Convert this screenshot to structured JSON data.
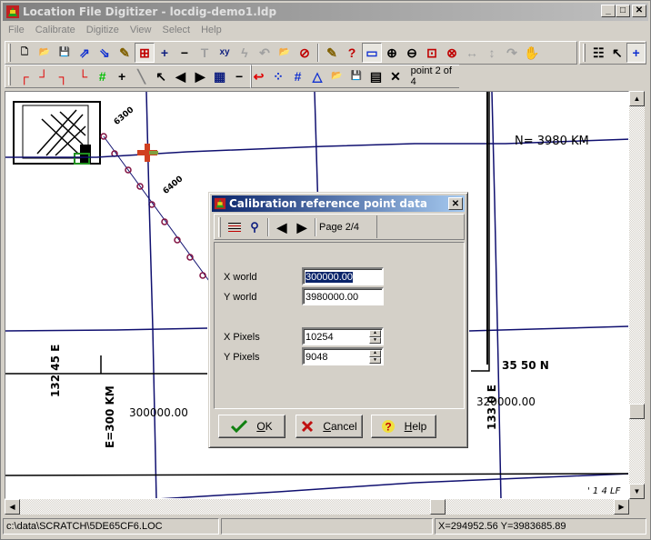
{
  "window": {
    "title": "Location File Digitizer - locdig-demo1.ldp",
    "buttons": {
      "minimize": "_",
      "maximize": "□",
      "close": "✕"
    }
  },
  "menu": [
    {
      "label": "File"
    },
    {
      "label": "Calibrate"
    },
    {
      "label": "Digitize"
    },
    {
      "label": "View"
    },
    {
      "label": "Select"
    },
    {
      "label": "Help"
    }
  ],
  "toolbar1": {
    "buttons": [
      {
        "name": "new-project",
        "glyph": "🗋",
        "color": "#000"
      },
      {
        "name": "open-project",
        "glyph": "📂",
        "color": "#c8a000"
      },
      {
        "name": "save-project",
        "glyph": "💾",
        "color": "#000"
      },
      {
        "name": "import",
        "glyph": "⇗",
        "color": "#1030d0"
      },
      {
        "name": "export",
        "glyph": "⇘",
        "color": "#1030d0"
      },
      {
        "name": "edit-notes",
        "glyph": "✎",
        "color": "#806000"
      },
      {
        "name": "calibrate-image",
        "glyph": "⊞",
        "color": "#c00000"
      },
      {
        "name": "add",
        "glyph": "+",
        "color": "#102080"
      },
      {
        "name": "remove",
        "glyph": "−",
        "color": "#000"
      },
      {
        "name": "text",
        "glyph": "T",
        "color": "#a0a0a0"
      },
      {
        "name": "xy-coords",
        "glyph": "xy",
        "color": "#102080"
      },
      {
        "name": "lightning",
        "glyph": "ϟ",
        "color": "#a0a0a0"
      },
      {
        "name": "undo",
        "glyph": "↶",
        "color": "#a0a0a0"
      },
      {
        "name": "open-image",
        "glyph": "📂",
        "color": "#c8a000"
      },
      {
        "name": "image-settings",
        "glyph": "⊘",
        "color": "#c00000"
      },
      {
        "name": "notes",
        "glyph": "✎",
        "color": "#806000"
      },
      {
        "name": "help",
        "glyph": "?",
        "color": "#c00000"
      },
      {
        "name": "select-rect",
        "glyph": "▭",
        "color": "#1030d0"
      },
      {
        "name": "zoom-in",
        "glyph": "⊕",
        "color": "#000"
      },
      {
        "name": "zoom-out",
        "glyph": "⊖",
        "color": "#000"
      },
      {
        "name": "zoom-window",
        "glyph": "⊡",
        "color": "#c00000"
      },
      {
        "name": "zoom-reset",
        "glyph": "⊗",
        "color": "#c00000"
      },
      {
        "name": "pan-horizontal",
        "glyph": "↔",
        "color": "#a0a0a0"
      },
      {
        "name": "pan-vertical",
        "glyph": "↕",
        "color": "#a0a0a0"
      },
      {
        "name": "redo",
        "glyph": "↷",
        "color": "#a0a0a0"
      },
      {
        "name": "hand",
        "glyph": "✋",
        "color": "#000"
      },
      {
        "name": "properties",
        "glyph": "☷",
        "color": "#000"
      },
      {
        "name": "pointer",
        "glyph": "↖",
        "color": "#000"
      },
      {
        "name": "crosshair",
        "glyph": "+",
        "color": "#1030d0"
      }
    ]
  },
  "toolbar2": {
    "buttons": [
      {
        "name": "corner-top-left",
        "glyph": "┌",
        "color": "#e00000"
      },
      {
        "name": "corner-top-right",
        "glyph": "┘",
        "color": "#e00000"
      },
      {
        "name": "corner-top-right-2",
        "glyph": "┐",
        "color": "#e00000"
      },
      {
        "name": "corner-bottom-left",
        "glyph": "└",
        "color": "#e00000"
      },
      {
        "name": "grid-point",
        "glyph": "#",
        "color": "#00c000"
      },
      {
        "name": "add-point",
        "glyph": "+",
        "color": "#000"
      },
      {
        "name": "pencil",
        "glyph": "╲",
        "color": "#808080"
      },
      {
        "name": "select-point",
        "glyph": "↖",
        "color": "#000"
      },
      {
        "name": "previous",
        "glyph": "◀",
        "color": "#000"
      },
      {
        "name": "next",
        "glyph": "▶",
        "color": "#000"
      },
      {
        "name": "measure",
        "glyph": "▦",
        "color": "#102080"
      },
      {
        "name": "delete-point",
        "glyph": "−",
        "color": "#000"
      },
      {
        "name": "return",
        "glyph": "↩",
        "color": "#e00000"
      },
      {
        "name": "scatter",
        "glyph": "⁘",
        "color": "#1030d0"
      },
      {
        "name": "grid",
        "glyph": "#",
        "color": "#1030d0"
      },
      {
        "name": "triangle",
        "glyph": "△",
        "color": "#1030d0"
      },
      {
        "name": "open",
        "glyph": "📂",
        "color": "#c8a000"
      },
      {
        "name": "save",
        "glyph": "💾",
        "color": "#000"
      },
      {
        "name": "table",
        "glyph": "▤",
        "color": "#000"
      },
      {
        "name": "close",
        "glyph": "✕",
        "color": "#000"
      }
    ],
    "status_text": "point 2 of 4"
  },
  "map": {
    "labels": {
      "n3980": "N= 3980 KM",
      "e300": "E=300 KM",
      "lon132": "132  45 E",
      "lon133": "133  0  E",
      "lat35": "35    50 N",
      "val300000": "300000.00",
      "val320000": "320000.00",
      "tick6300": "6300",
      "tick6400": "6400",
      "corner": "' 1 4 LF"
    }
  },
  "dialog": {
    "title": "Calibration reference point data",
    "page_label": "Page 2/4",
    "fields": {
      "x_world": {
        "label": "X world",
        "value": "300000.00"
      },
      "y_world": {
        "label": "Y world",
        "value": "3980000.00"
      },
      "x_pixels": {
        "label": "X Pixels",
        "value": "10254"
      },
      "y_pixels": {
        "label": "Y Pixels",
        "value": "9048"
      }
    },
    "buttons": {
      "ok": {
        "accel": "O",
        "rest": "K"
      },
      "cancel": {
        "accel": "C",
        "rest": "ancel"
      },
      "help": {
        "accel": "H",
        "rest": "elp"
      }
    }
  },
  "statusbar": {
    "file_path": "c:\\data\\SCRATCH\\5DE65CF6.LOC",
    "middle": "",
    "coords": "X=294952.56 Y=3983685.89"
  }
}
